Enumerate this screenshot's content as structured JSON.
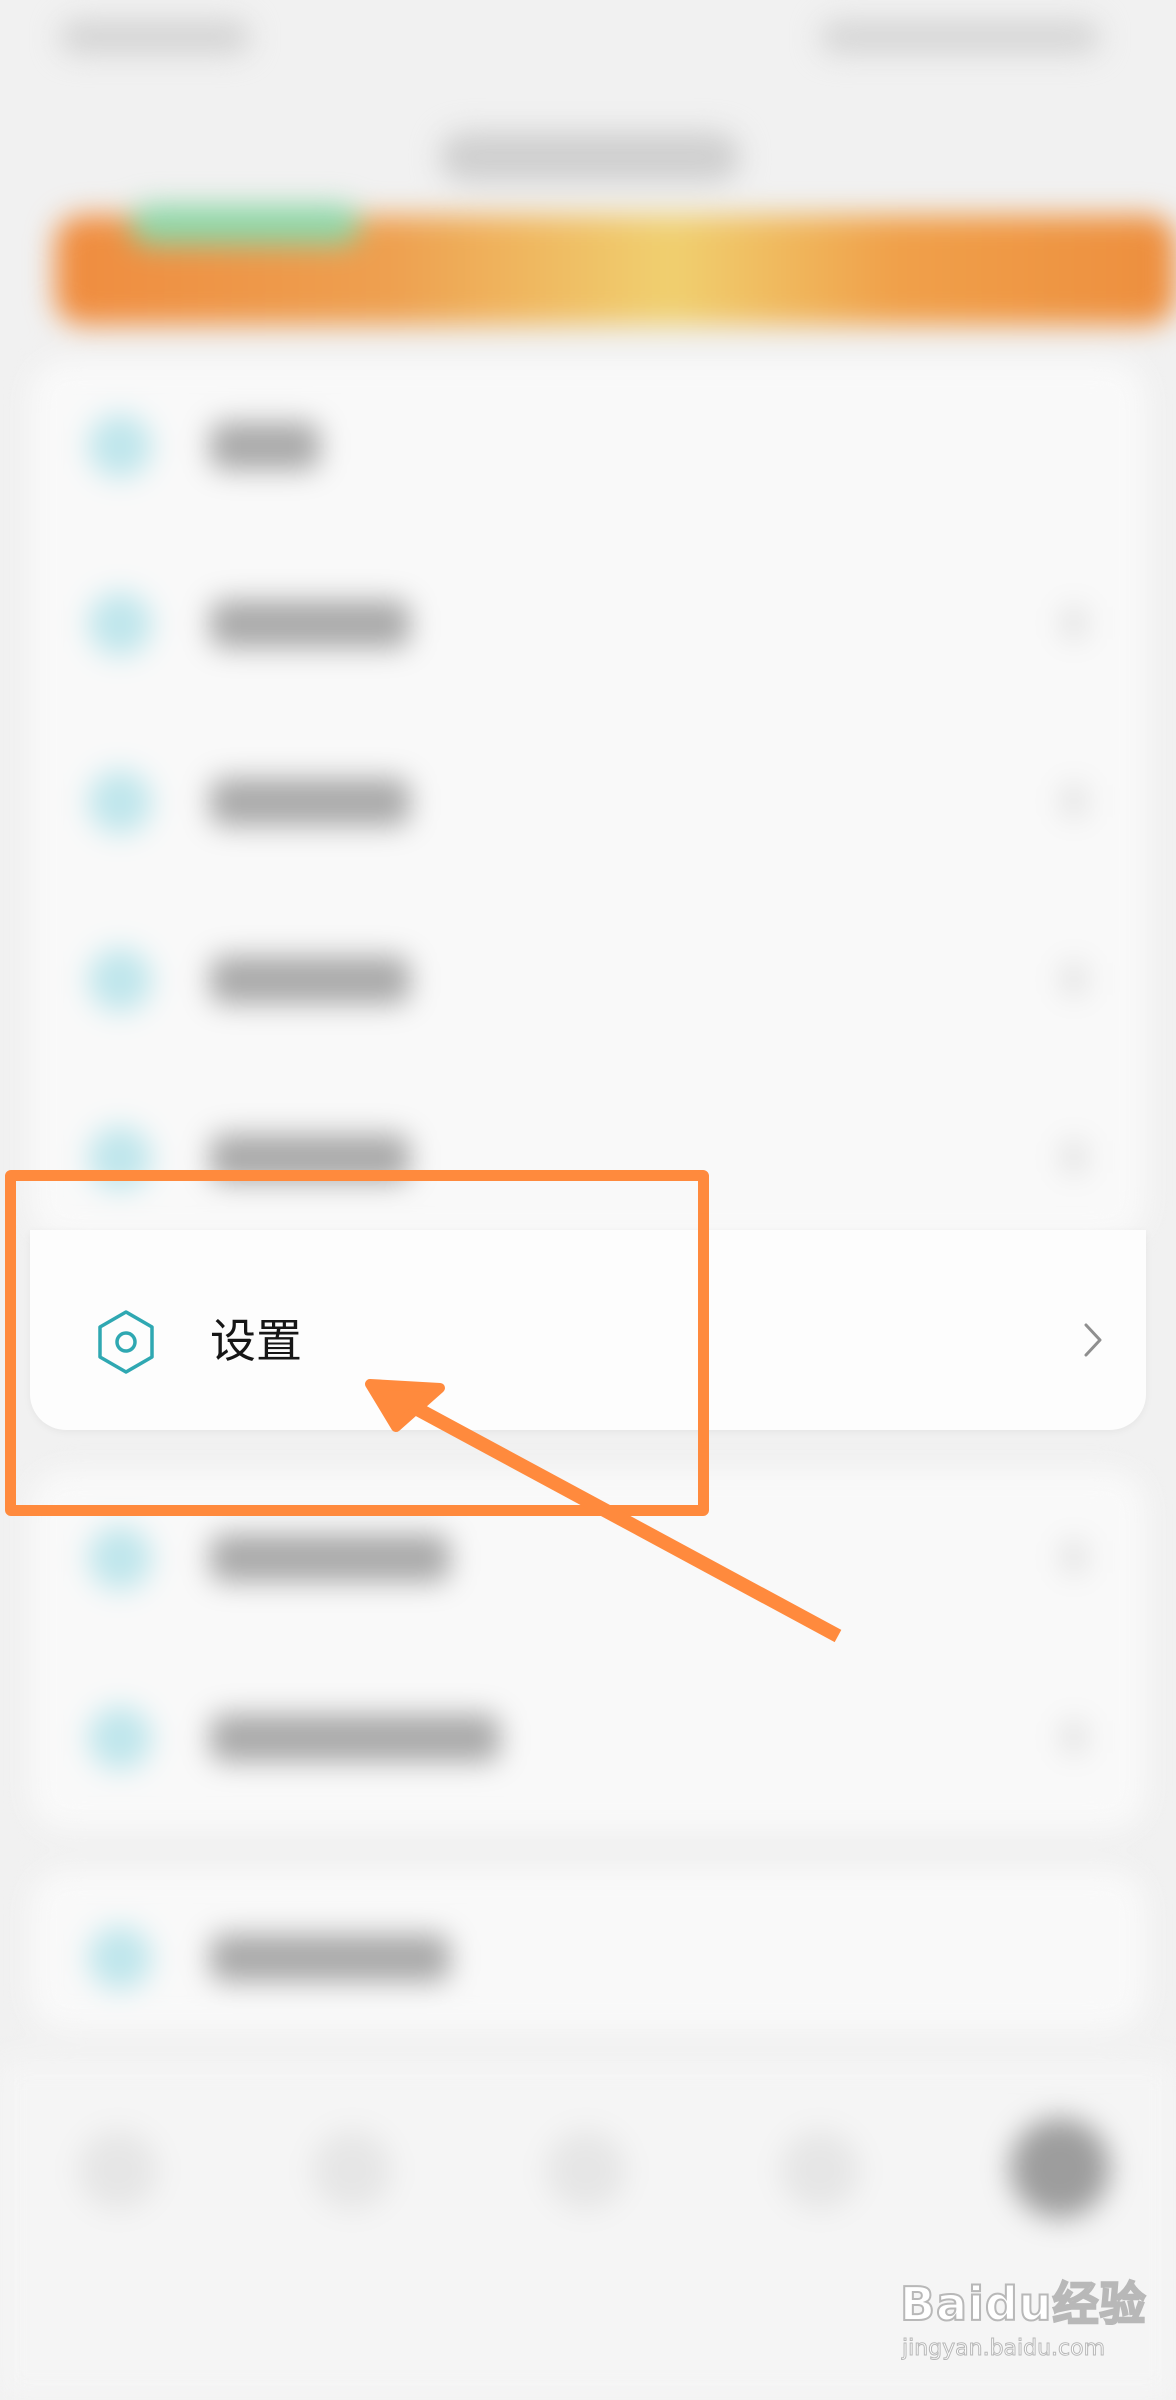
{
  "settings_row": {
    "label": "设置",
    "icon": "hexagon-settings-icon",
    "icon_color": "#2fa8b2",
    "chevron": "chevron-right-icon"
  },
  "annotation": {
    "highlight_color": "#ff8a3d",
    "arrow_color": "#ff8a3d"
  },
  "watermark": {
    "logo": "Baidu经验",
    "url": "jingyan.baidu.com"
  }
}
